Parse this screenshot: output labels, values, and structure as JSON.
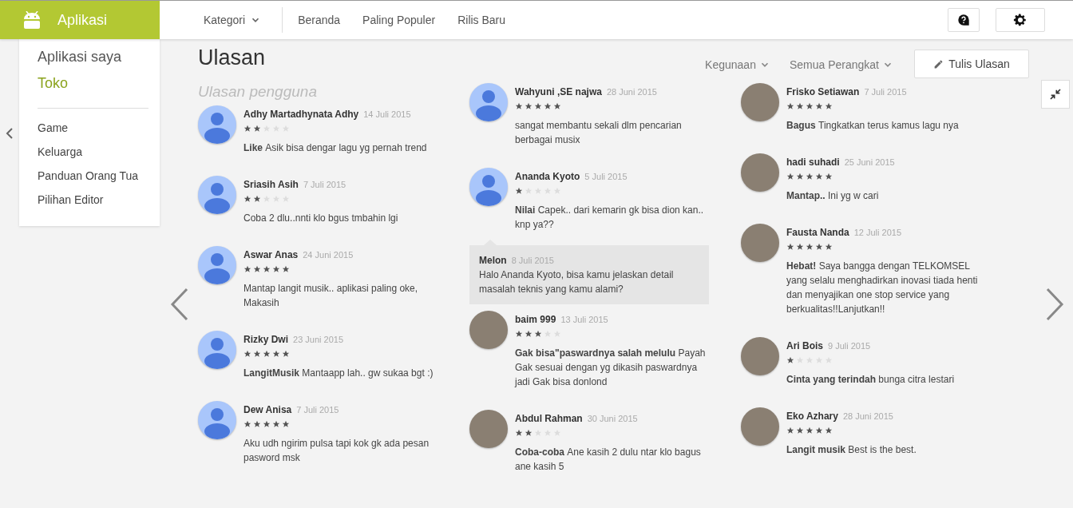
{
  "brand": {
    "title": "Aplikasi"
  },
  "nav": {
    "category": "Kategori",
    "links": [
      "Beranda",
      "Paling Populer",
      "Rilis Baru"
    ]
  },
  "sidebar": {
    "items": [
      {
        "label": "Aplikasi saya",
        "selected": false
      },
      {
        "label": "Toko",
        "selected": true
      }
    ],
    "categories": [
      "Game",
      "Keluarga",
      "Panduan Orang Tua",
      "Pilihan Editor"
    ]
  },
  "page_title": "Ulasan",
  "filters": [
    "Kegunaan",
    "Semua Perangkat"
  ],
  "write_button": "Tulis Ulasan",
  "section_title": "Ulasan pengguna",
  "columns": [
    {
      "reviews": [
        {
          "kind": "default",
          "name": "Adhy Martadhynata Adhy",
          "date": "14 Juli 2015",
          "stars": 2,
          "title": "Like",
          "body": "Asik bisa dengar lagu yg pernah trend"
        },
        {
          "kind": "default",
          "name": "Sriasih Asih",
          "date": "7 Juli 2015",
          "stars": 2,
          "body": "Coba 2 dlu..nnti klo bgus tmbahin lgi"
        },
        {
          "kind": "default",
          "name": "Aswar Anas",
          "date": "24 Juni 2015",
          "stars": 5,
          "body": "Mantap langit musik.. aplikasi paling oke, Makasih"
        },
        {
          "kind": "default",
          "name": "Rizky Dwi",
          "date": "23 Juni 2015",
          "stars": 5,
          "title": "LangitMusik",
          "body": "Mantaapp lah.. gw sukaa bgt :)"
        },
        {
          "kind": "default",
          "name": "Dew Anisa",
          "date": "7 Juli 2015",
          "stars": 5,
          "body": "Aku udh ngirim pulsa tapi kok gk ada pesan pasword msk"
        }
      ]
    },
    {
      "reviews": [
        {
          "kind": "default",
          "name": "Wahyuni ,SE najwa",
          "date": "28 Juni 2015",
          "stars": 5,
          "body": "sangat membantu sekali dlm pencarian berbagai musix"
        },
        {
          "kind": "default",
          "name": "Ananda Kyoto",
          "date": "5 Juli 2015",
          "stars": 1,
          "title": "Nilai",
          "body": "Capek.. dari kemarin gk bisa dion kan.. knp ya??",
          "reply": {
            "author": "Melon",
            "date": "8 Juli 2015",
            "text": "Halo Ananda Kyoto, bisa kamu jelaskan detail masalah teknis yang kamu alami?"
          }
        },
        {
          "kind": "photo",
          "name": "baim 999",
          "date": "13 Juli 2015",
          "stars": 3,
          "title": "Gak bisa\"paswardnya salah melulu",
          "body": "Payah Gak sesuai dengan yg dikasih paswardnya jadi Gak bisa donlond"
        },
        {
          "kind": "photo",
          "name": "Abdul Rahman",
          "date": "30 Juni 2015",
          "stars": 2,
          "title": "Coba-coba",
          "body": "Ane kasih 2 dulu ntar klo bagus ane kasih 5"
        }
      ]
    },
    {
      "reviews": [
        {
          "kind": "photo",
          "name": "Frisko Setiawan",
          "date": "7 Juli 2015",
          "stars": 5,
          "title": "Bagus",
          "body": "Tingkatkan terus kamus lagu nya"
        },
        {
          "kind": "photo",
          "name": "hadi suhadi",
          "date": "25 Juni 2015",
          "stars": 5,
          "title": "Mantap..",
          "body": "Ini yg w cari"
        },
        {
          "kind": "photo",
          "name": "Fausta Nanda",
          "date": "12 Juli 2015",
          "stars": 5,
          "title": "Hebat!",
          "body": "Saya bangga dengan TELKOMSEL yang selalu menghadirkan inovasi tiada henti dan menyajikan one stop service yang berkualitas!!Lanjutkan!!"
        },
        {
          "kind": "photo",
          "name": "Ari Bois",
          "date": "9 Juli 2015",
          "stars": 1,
          "title": "Cinta yang terindah",
          "body": "bunga citra lestari"
        },
        {
          "kind": "photo",
          "name": "Eko Azhary",
          "date": "28 Juni 2015",
          "stars": 5,
          "title": "Langit musik",
          "body": "Best is the best."
        }
      ]
    }
  ]
}
